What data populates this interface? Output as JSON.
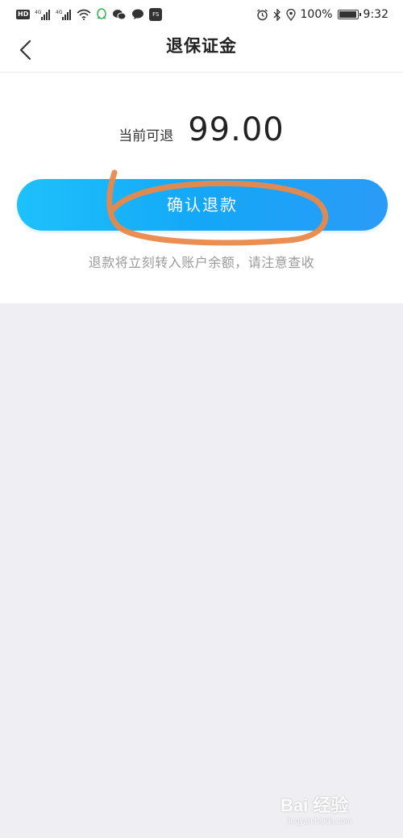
{
  "status_bar": {
    "left_icons": [
      "hd-icon",
      "4g-signal-icon",
      "4g-signal-icon",
      "wifi-icon",
      "qq-icon",
      "wechat-icon",
      "message-icon",
      "app-icon"
    ],
    "network_label_1": "4G",
    "network_label_2": "4G",
    "hd_label": "HD",
    "app_badge_label": "FS",
    "right_icons": [
      "alarm-icon",
      "bluetooth-icon",
      "location-icon"
    ],
    "battery_percent": "100%",
    "battery_level": 1.0,
    "time": "9:32"
  },
  "nav": {
    "title": "退保证金",
    "back_icon": "chevron-left-icon"
  },
  "refund": {
    "amount_label": "当前可退",
    "amount_value": "99.00",
    "confirm_label": "确认退款",
    "note": "退款将立刻转入账户余额，请注意查收"
  },
  "colors": {
    "button_gradient_start": "#1ec1fb",
    "button_gradient_end": "#2a9bf7",
    "annotation_stroke": "#e8894a",
    "page_background": "#efeef2",
    "card_background": "#ffffff",
    "note_text": "#9a9a9a"
  },
  "watermark": {
    "brand": "Bai 经验",
    "url": "jingyan.baidu.com"
  }
}
